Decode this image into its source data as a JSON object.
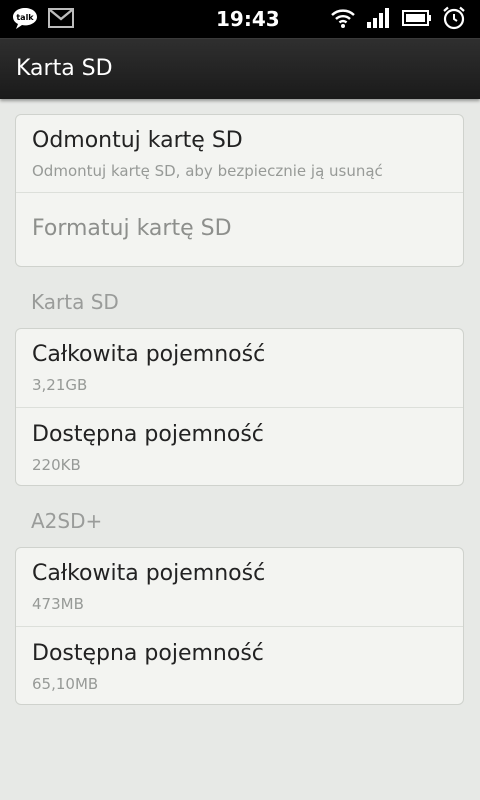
{
  "status_bar": {
    "time": "19:43",
    "notifications": [
      {
        "icon": "talk-icon",
        "label": "talk"
      },
      {
        "icon": "gmail-icon"
      }
    ],
    "indicators": [
      "wifi-icon",
      "signal-icon",
      "battery-icon",
      "alarm-icon"
    ]
  },
  "title_bar": {
    "title": "Karta SD"
  },
  "actions_card": {
    "unmount": {
      "title": "Odmontuj kartę SD",
      "summary": "Odmontuj kartę SD, aby bezpiecznie ją usunąć"
    },
    "format": {
      "title": "Formatuj kartę SD",
      "enabled": false
    }
  },
  "sd_section": {
    "header": "Karta SD",
    "rows": [
      {
        "title": "Całkowita pojemność",
        "value": "3,21GB"
      },
      {
        "title": "Dostępna pojemność",
        "value": "220KB"
      }
    ]
  },
  "a2sd_section": {
    "header": "A2SD+",
    "rows": [
      {
        "title": "Całkowita pojemność",
        "value": "473MB"
      },
      {
        "title": "Dostępna pojemność",
        "value": "65,10MB"
      }
    ]
  },
  "colors": {
    "background": "#e7e9e6",
    "card": "#f3f4f1",
    "title_bar": "#222222",
    "status_bar": "#000000"
  }
}
